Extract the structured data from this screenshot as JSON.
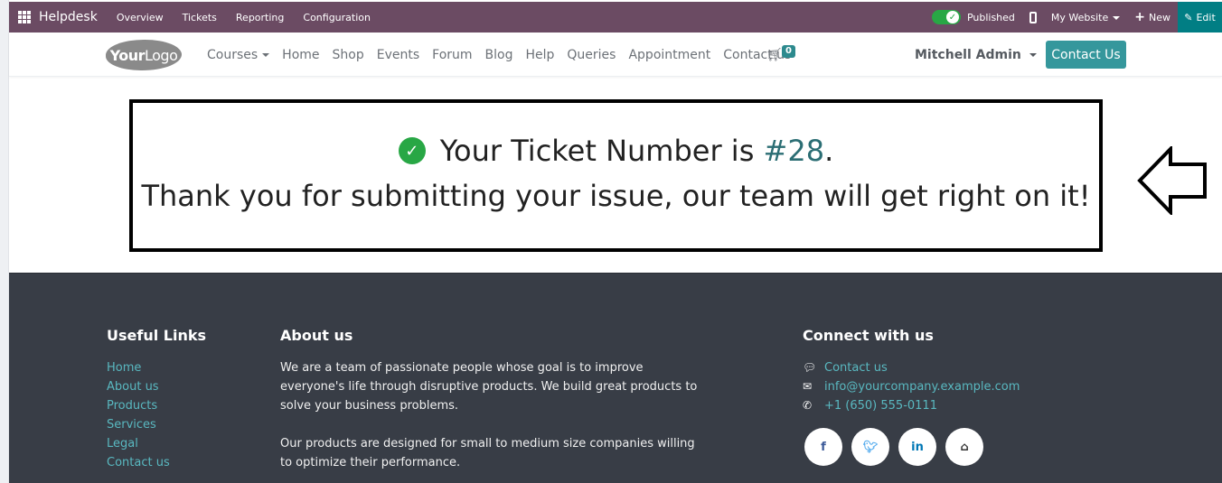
{
  "topbar": {
    "app_name": "Helpdesk",
    "menu": [
      "Overview",
      "Tickets",
      "Reporting",
      "Configuration"
    ],
    "published_label": "Published",
    "published": true,
    "website_label": "My Website",
    "new_label": "New",
    "edit_label": "Edit"
  },
  "navbar": {
    "logo_bold": "Your",
    "logo_light": "Logo",
    "items": [
      "Courses",
      "Home",
      "Shop",
      "Events",
      "Forum",
      "Blog",
      "Help",
      "Queries",
      "Appointment",
      "Contact us"
    ],
    "cart_count": "0",
    "user_name": "Mitchell Admin",
    "contact_button": "Contact Us"
  },
  "confirmation": {
    "prefix": "Your Ticket Number is ",
    "ticket_number": "#28",
    "suffix": ".",
    "message": "Thank you for submitting your issue, our team will get right on it!"
  },
  "footer": {
    "useful_links_title": "Useful Links",
    "useful_links": [
      "Home",
      "About us",
      "Products",
      "Services",
      "Legal",
      "Contact us"
    ],
    "about_title": "About us",
    "about_paragraphs": [
      "We are a team of passionate people whose goal is to improve everyone's life through disruptive products. We build great products to solve your business problems.",
      "Our products are designed for small to medium size companies willing to optimize their performance."
    ],
    "connect_title": "Connect with us",
    "contact_link": "Contact us",
    "email": "info@yourcompany.example.com",
    "phone": "+1 (650) 555-0111",
    "social": [
      "facebook",
      "twitter",
      "linkedin",
      "home"
    ]
  },
  "colors": {
    "admin_bar": "#6b4b63",
    "edit_button": "#017e84",
    "accent": "#35979c",
    "ticket_number": "#2b6e74",
    "success": "#28a745",
    "footer_bg": "#383d46",
    "footer_link": "#59b8c0"
  }
}
